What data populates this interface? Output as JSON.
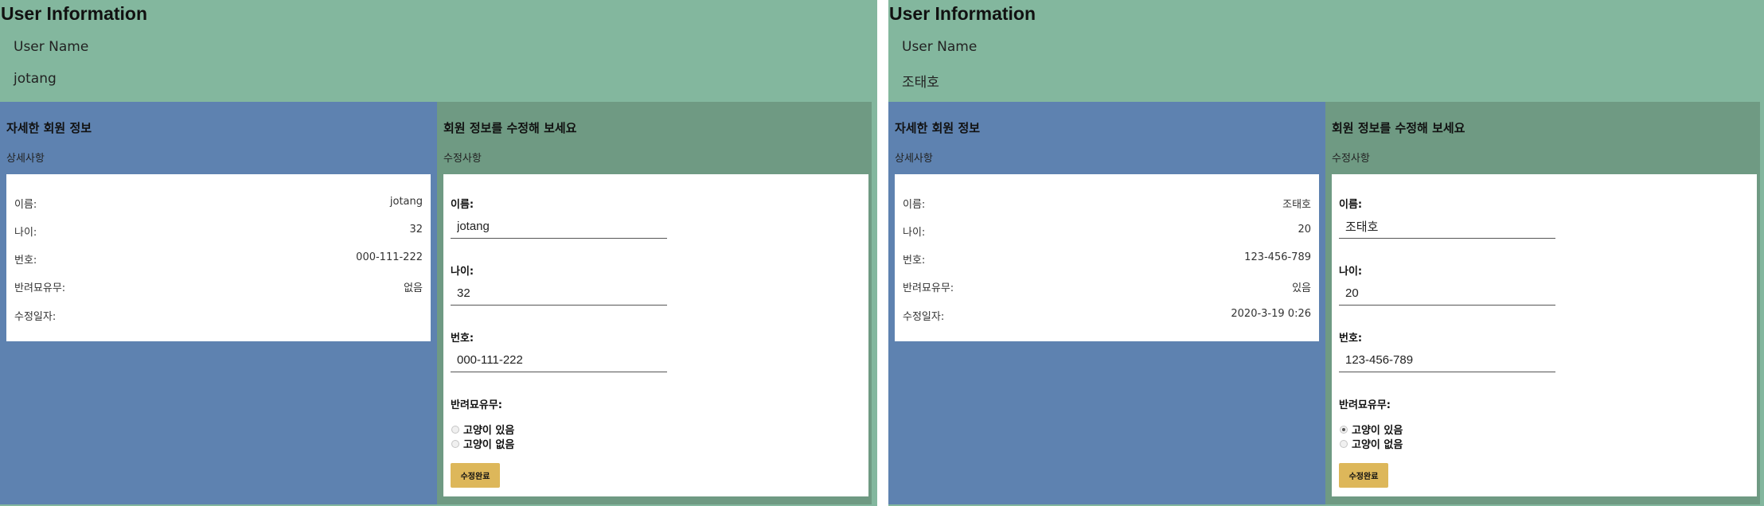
{
  "screens": [
    {
      "app_title": "User Information",
      "user_name_label": "User Name",
      "user_name_value": "jotang",
      "detail": {
        "title": "자세한 회원 정보",
        "subtitle": "상세사항",
        "rows": [
          {
            "label": "이름:",
            "value": "jotang"
          },
          {
            "label": "나이:",
            "value": "32"
          },
          {
            "label": "번호:",
            "value": "000-111-222"
          },
          {
            "label": "반려묘유무:",
            "value": "없음"
          },
          {
            "label": "수정일자:",
            "value": ""
          }
        ]
      },
      "edit": {
        "title": "회원 정보를 수정해 보세요",
        "subtitle": "수정사항",
        "name_label": "이름:",
        "name_value": "jotang",
        "age_label": "나이:",
        "age_value": "32",
        "phone_label": "번호:",
        "phone_value": "000-111-222",
        "cat_label": "반려묘유무:",
        "cat_options": [
          {
            "label": "고양이 있음",
            "checked": false
          },
          {
            "label": "고양이 없음",
            "checked": false
          }
        ],
        "submit_label": "수정완료"
      }
    },
    {
      "app_title": "User Information",
      "user_name_label": "User Name",
      "user_name_value": "조태호",
      "detail": {
        "title": "자세한 회원 정보",
        "subtitle": "상세사항",
        "rows": [
          {
            "label": "이름:",
            "value": "조태호"
          },
          {
            "label": "나이:",
            "value": "20"
          },
          {
            "label": "번호:",
            "value": "123-456-789"
          },
          {
            "label": "반려묘유무:",
            "value": "있음"
          },
          {
            "label": "수정일자:",
            "value": "2020-3-19 0:26"
          }
        ]
      },
      "edit": {
        "title": "회원 정보를 수정해 보세요",
        "subtitle": "수정사항",
        "name_label": "이름:",
        "name_value": "조태호",
        "age_label": "나이:",
        "age_value": "20",
        "phone_label": "번호:",
        "phone_value": "123-456-789",
        "cat_label": "반려묘유무:",
        "cat_options": [
          {
            "label": "고양이 있음",
            "checked": true
          },
          {
            "label": "고양이 없음",
            "checked": false
          }
        ],
        "submit_label": "수정완료"
      }
    }
  ],
  "colors": {
    "background": "#83b79e",
    "detail_panel": "#5e82b0",
    "edit_panel": "#6f9a83",
    "button": "#ddb75a"
  }
}
